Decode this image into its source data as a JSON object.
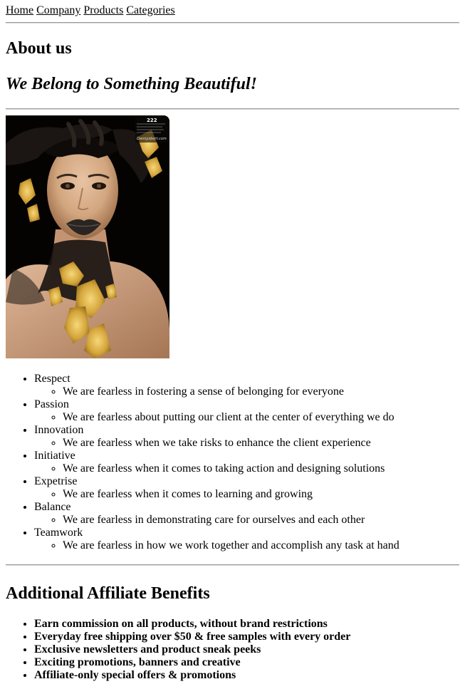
{
  "nav": {
    "items": [
      "Home",
      "Company",
      "Products",
      "Categories"
    ]
  },
  "about": {
    "heading": "About us",
    "tagline": "We Belong to Something Beautiful!"
  },
  "photo": {
    "alt": "Model with black and gold leaf makeup",
    "overlay_number": "222",
    "overlay_credit": "Dannyxbert.com",
    "colors": {
      "background": "#050302",
      "skin": "#d9b08e",
      "gold": "#d4a53a",
      "black_paint": "#1a1512"
    }
  },
  "values": [
    {
      "title": "Respect",
      "description": "We are fearless in fostering a sense of belonging for everyone"
    },
    {
      "title": "Passion",
      "description": "We are fearless about putting our client at the center of everything we do"
    },
    {
      "title": "Innovation",
      "description": "We are fearless when we take risks to enhance the client experience"
    },
    {
      "title": "Initiative",
      "description": "We are fearless when it comes to taking action and designing solutions"
    },
    {
      "title": "Expetrise",
      "description": "We are fearless when it comes to learning and growing"
    },
    {
      "title": "Balance",
      "description": "We are fearless in demonstrating care for ourselves and each other"
    },
    {
      "title": "Teamwork",
      "description": "We are fearless in how we work together and accomplish any task at hand"
    }
  ],
  "benefits": {
    "heading": "Additional Affiliate Benefits",
    "items": [
      "Earn commission on all products, without brand restrictions",
      "Everyday free shipping over $50 & free samples with every order",
      "Exclusive newsletters and product sneak peeks",
      "Exciting promotions, banners and creative",
      "Affiliate-only special offers & promotions"
    ]
  }
}
